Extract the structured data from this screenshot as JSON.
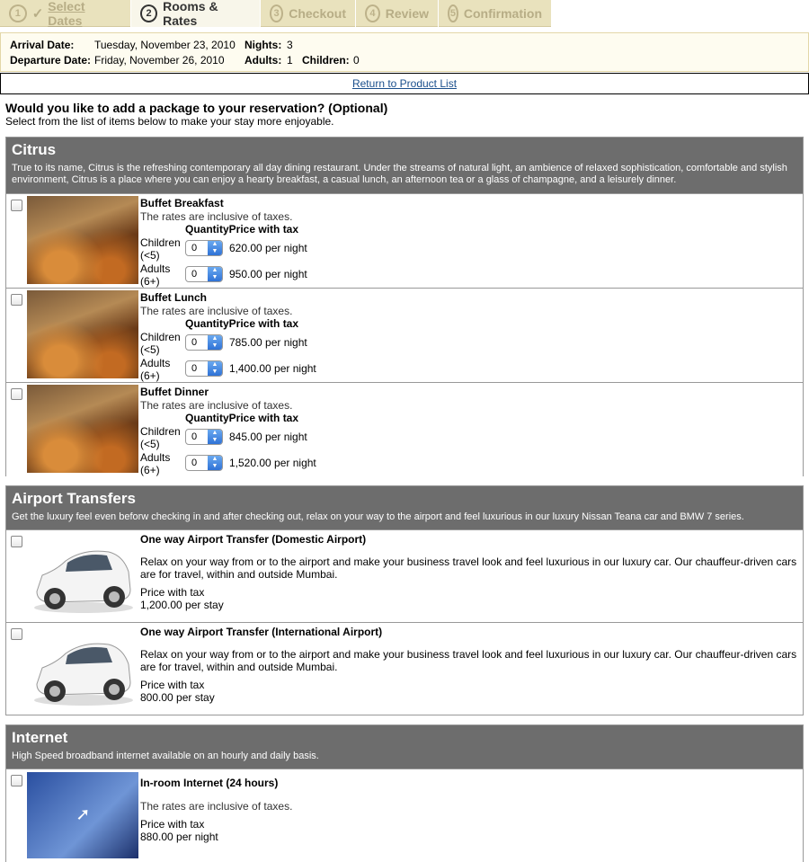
{
  "steps": [
    {
      "num": "1",
      "label": "Select Dates",
      "state": "done"
    },
    {
      "num": "2",
      "label": "Rooms & Rates",
      "state": "active"
    },
    {
      "num": "3",
      "label": "Checkout",
      "state": "inactive"
    },
    {
      "num": "4",
      "label": "Review",
      "state": "inactive"
    },
    {
      "num": "5",
      "label": "Confirmation",
      "state": "inactive"
    }
  ],
  "stay": {
    "arrival_label": "Arrival Date:",
    "arrival_value": "Tuesday, November 23, 2010",
    "departure_label": "Departure Date:",
    "departure_value": "Friday, November 26, 2010",
    "nights_label": "Nights:",
    "nights_value": "3",
    "adults_label": "Adults:",
    "adults_value": "1",
    "children_label": "Children:",
    "children_value": "0"
  },
  "return_link": "Return to Product List",
  "heading": "Would you like to add a package to your reservation? (Optional)",
  "subheading": "Select from the list of items below to make your stay more enjoyable.",
  "citrus": {
    "name": "Citrus",
    "desc": "True to its name, Citrus is the refreshing contemporary all day dining restaurant. Under the streams of natural light, an ambience of relaxed sophistication, comfortable and stylish environment, Citrus is a place where you can enjoy a hearty breakfast, a casual lunch, an afternoon tea or a glass of champagne, and a leisurely dinner.",
    "items": [
      {
        "name": "Buffet Breakfast",
        "note": "The rates are inclusive of taxes.",
        "qty_header": "Quantity",
        "price_header": "Price with tax",
        "children_label": "Children (<5)",
        "children_qty": "0",
        "children_price": "620.00 per night",
        "adults_label": "Adults (6+)",
        "adults_qty": "0",
        "adults_price": "950.00 per night"
      },
      {
        "name": "Buffet Lunch",
        "note": "The rates are inclusive of taxes.",
        "qty_header": "Quantity",
        "price_header": "Price with tax",
        "children_label": "Children (<5)",
        "children_qty": "0",
        "children_price": "785.00 per night",
        "adults_label": "Adults (6+)",
        "adults_qty": "0",
        "adults_price": "1,400.00 per night"
      },
      {
        "name": "Buffet Dinner",
        "note": "The rates are inclusive of taxes.",
        "qty_header": "Quantity",
        "price_header": "Price with tax",
        "children_label": "Children (<5)",
        "children_qty": "0",
        "children_price": "845.00 per night",
        "adults_label": "Adults (6+)",
        "adults_qty": "0",
        "adults_price": "1,520.00 per night"
      }
    ]
  },
  "airport": {
    "name": "Airport Transfers",
    "desc": "Get the luxury feel even beforw checking in and after checking out, relax on your way to the airport and feel luxurious in our luxury Nissan Teana car and BMW 7 series.",
    "items": [
      {
        "name": "One way Airport Transfer (Domestic Airport)",
        "desc": "Relax on your way from or to the airport and make your business travel look and feel luxurious in our luxury car. Our chauffeur-driven cars are for travel, within and outside Mumbai.",
        "price_label": "Price with tax",
        "price": "1,200.00 per stay"
      },
      {
        "name": "One way Airport Transfer (International Airport)",
        "desc": "Relax on your way from or to the airport and make your business travel look and feel luxurious in our luxury car. Our chauffeur-driven cars are for travel, within and outside Mumbai.",
        "price_label": "Price with tax",
        "price": "800.00 per stay"
      }
    ]
  },
  "internet": {
    "name": "Internet",
    "desc": "High Speed broadband internet available on an hourly and daily basis.",
    "items": [
      {
        "name": "In-room Internet (24 hours)",
        "note": "The rates are inclusive of taxes.",
        "price_label": "Price with tax",
        "price": "880.00 per night"
      }
    ]
  },
  "colors": {
    "section_header": "#6d6d6d",
    "steps_bg": "#e9e2bd",
    "info_bg": "#fefcf0",
    "link": "#1a4f8c"
  }
}
